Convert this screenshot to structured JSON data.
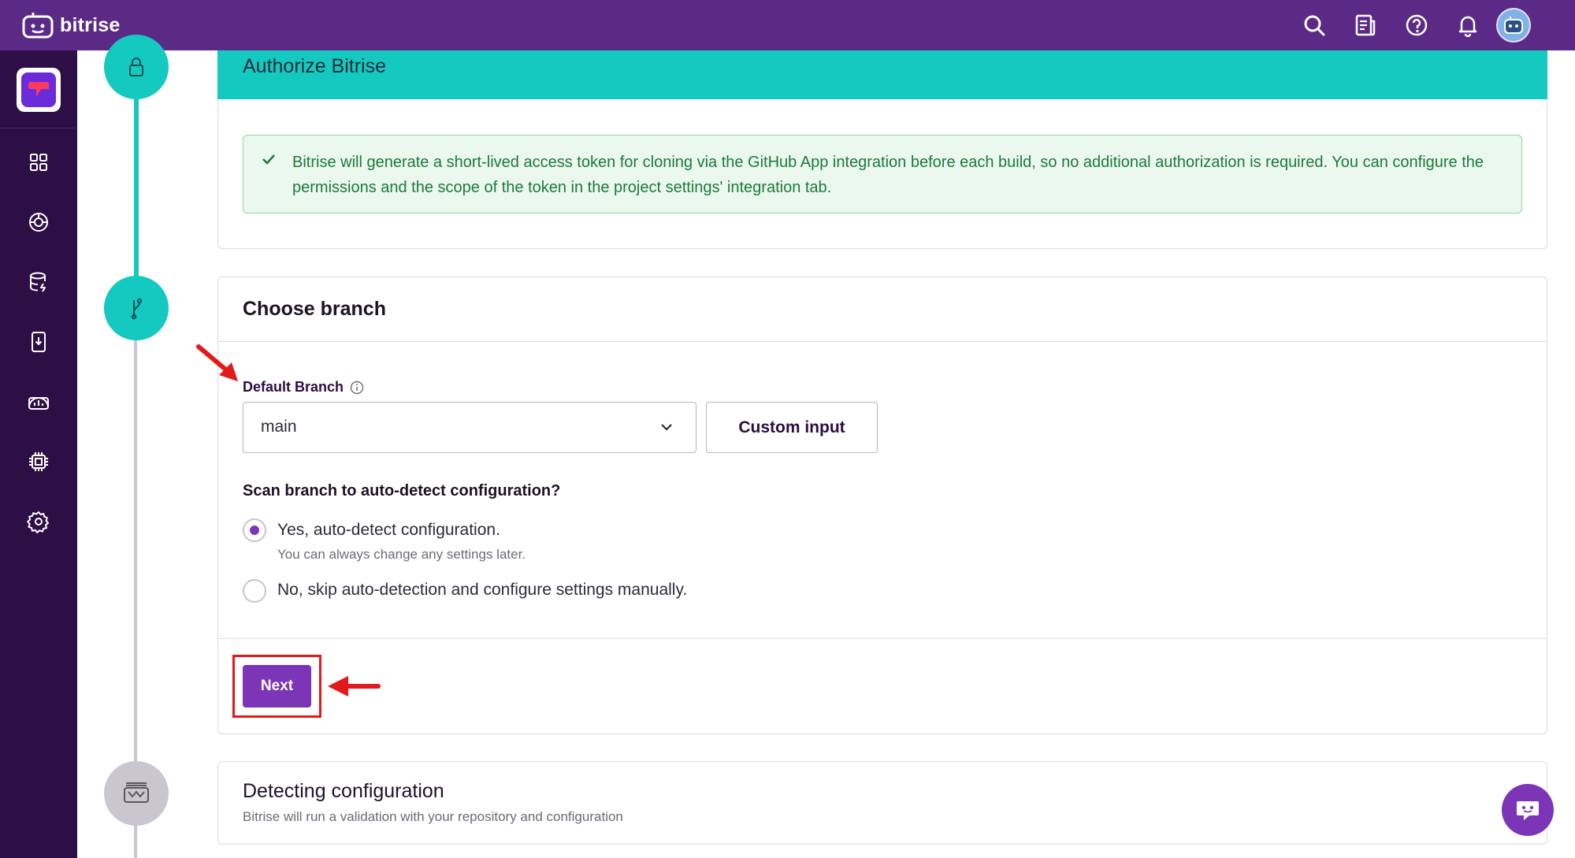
{
  "topbar": {
    "brand": "bitrise",
    "icons": [
      "search-icon",
      "docs-icon",
      "help-icon",
      "bell-icon",
      "avatar"
    ]
  },
  "sidebar": {
    "items": [
      "dashboard-icon",
      "builds-icon",
      "storage-icon",
      "device-icon",
      "insights-icon",
      "chip-icon",
      "settings-icon"
    ]
  },
  "authorize": {
    "title": "Authorize Bitrise",
    "notice": "Bitrise will generate a short-lived access token for cloning via the GitHub App integration before each build, so no additional authorization is required. You can configure the permissions and the scope of the token in the project settings' integration tab."
  },
  "branch": {
    "title": "Choose branch",
    "default_branch_label": "Default Branch",
    "selected_branch": "main",
    "custom_input_label": "Custom input",
    "scan_question": "Scan branch to auto-detect configuration?",
    "options": [
      {
        "label": "Yes, auto-detect configuration.",
        "sub": "You can always change any settings later.",
        "selected": true
      },
      {
        "label": "No, skip auto-detection and configure settings manually.",
        "sub": "",
        "selected": false
      }
    ],
    "next_label": "Next"
  },
  "detecting": {
    "title": "Detecting configuration",
    "subtitle": "Bitrise will run a validation with your repository and configuration"
  },
  "colors": {
    "topbar": "#5b2a86",
    "sidebar": "#2d0f45",
    "teal": "#14c9c0",
    "primary": "#7b35b6",
    "annotation_red": "#e3191a"
  }
}
